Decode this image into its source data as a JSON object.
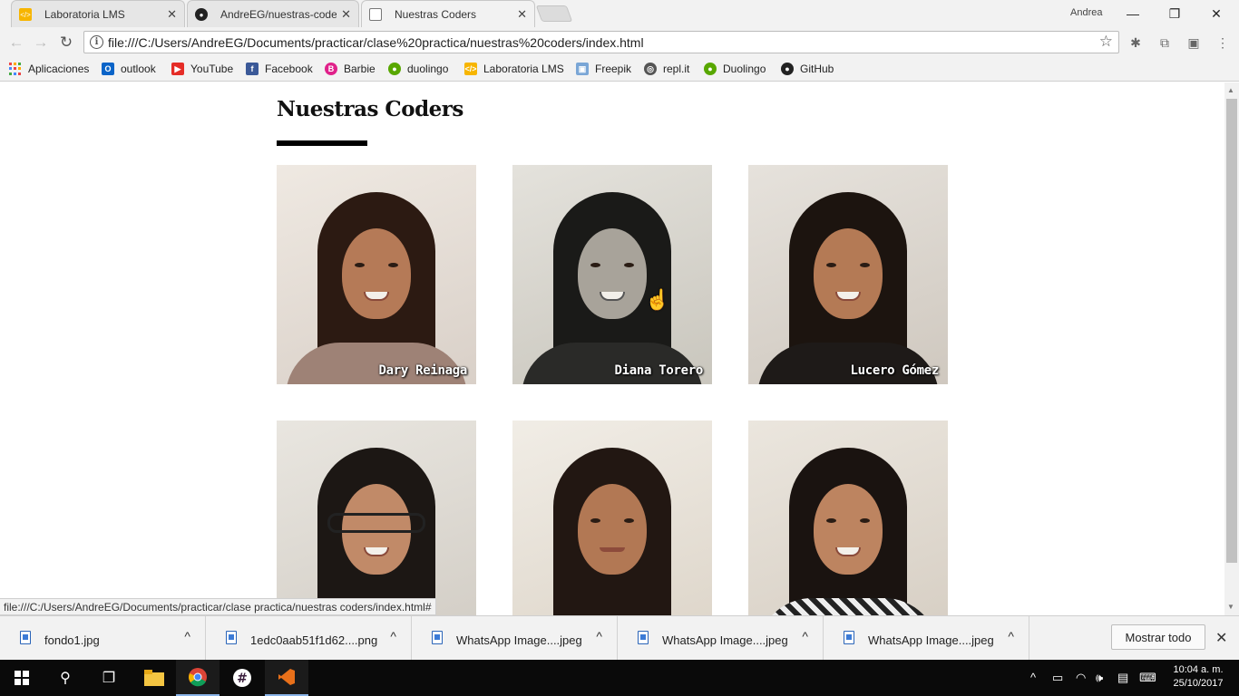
{
  "browser": {
    "tabs": [
      {
        "title": "Laboratoria LMS",
        "favicon": "laboratoria-icon",
        "active": false
      },
      {
        "title": "AndreEG/nuestras-coders",
        "favicon": "github-icon",
        "active": false
      },
      {
        "title": "Nuestras Coders",
        "favicon": "document-icon",
        "active": true
      }
    ],
    "profile_name": "Andrea",
    "window_controls": {
      "minimize": "—",
      "restore": "❐",
      "close": "✕"
    },
    "address": "file:///C:/Users/AndreEG/Documents/practicar/clase%20practica/nuestras%20coders/index.html",
    "bookmarks": [
      {
        "label": "Aplicaciones",
        "icon": "apps-grid-icon"
      },
      {
        "label": "outlook",
        "icon": "outlook-icon"
      },
      {
        "label": "YouTube",
        "icon": "youtube-icon"
      },
      {
        "label": "Facebook",
        "icon": "facebook-icon"
      },
      {
        "label": "Barbie",
        "icon": "barbie-icon"
      },
      {
        "label": "duolingo",
        "icon": "duolingo-icon"
      },
      {
        "label": "Laboratoria LMS",
        "icon": "laboratoria-icon"
      },
      {
        "label": "Freepik",
        "icon": "freepik-icon"
      },
      {
        "label": "repl.it",
        "icon": "replit-icon"
      },
      {
        "label": "Duolingo",
        "icon": "duolingo-icon"
      },
      {
        "label": "GitHub",
        "icon": "github-icon"
      }
    ]
  },
  "page": {
    "title": "Nuestras Coders",
    "coders": [
      {
        "name": "Dary Reinaga"
      },
      {
        "name": "Diana Torero"
      },
      {
        "name": "Lucero Gómez"
      },
      {
        "name": ""
      },
      {
        "name": ""
      },
      {
        "name": ""
      }
    ]
  },
  "status_url": "file:///C:/Users/AndreEG/Documents/practicar/clase practica/nuestras coders/index.html#",
  "downloads": {
    "items": [
      {
        "name": "fondo1.jpg"
      },
      {
        "name": "1edc0aab51f1d62....png"
      },
      {
        "name": "WhatsApp Image....jpeg"
      },
      {
        "name": "WhatsApp Image....jpeg"
      },
      {
        "name": "WhatsApp Image....jpeg"
      }
    ],
    "show_all_label": "Mostrar todo"
  },
  "taskbar": {
    "time": "10:04 a. m.",
    "date": "25/10/2017"
  },
  "colors": {
    "chrome_bg": "#f2f2f2",
    "title_underline": "#000000",
    "taskbar_bg": "#0a0a0a"
  }
}
